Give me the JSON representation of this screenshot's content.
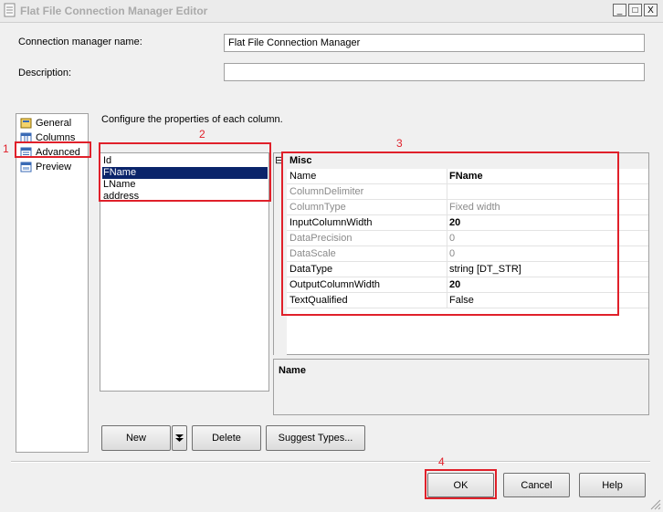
{
  "window": {
    "title": "Flat File Connection Manager Editor",
    "minimize_glyph": "_",
    "maximize_glyph": "□",
    "close_glyph": "X"
  },
  "form": {
    "name_label": "Connection manager name:",
    "name_value": "Flat File Connection Manager",
    "description_label": "Description:",
    "description_value": ""
  },
  "nav": {
    "items": [
      {
        "label": "General",
        "icon": "general-icon"
      },
      {
        "label": "Columns",
        "icon": "columns-icon"
      },
      {
        "label": "Advanced",
        "icon": "advanced-icon",
        "selected": true
      },
      {
        "label": "Preview",
        "icon": "preview-icon"
      }
    ]
  },
  "advanced": {
    "instruction": "Configure the properties of each column.",
    "columns": [
      "Id",
      "FName",
      "LName",
      "address"
    ],
    "selected_column": "FName"
  },
  "properties": {
    "category": "Misc",
    "collapse_glyph": "⊟",
    "rows": [
      {
        "name": "Name",
        "value": "FName",
        "enabled": true,
        "value_bold": true
      },
      {
        "name": "ColumnDelimiter",
        "value": "",
        "enabled": false,
        "value_bold": false
      },
      {
        "name": "ColumnType",
        "value": "Fixed width",
        "enabled": false,
        "value_bold": false
      },
      {
        "name": "InputColumnWidth",
        "value": "20",
        "enabled": true,
        "value_bold": true
      },
      {
        "name": "DataPrecision",
        "value": "0",
        "enabled": false,
        "value_bold": false
      },
      {
        "name": "DataScale",
        "value": "0",
        "enabled": false,
        "value_bold": false
      },
      {
        "name": "DataType",
        "value": "string [DT_STR]",
        "enabled": true,
        "value_bold": false
      },
      {
        "name": "OutputColumnWidth",
        "value": "20",
        "enabled": true,
        "value_bold": true
      },
      {
        "name": "TextQualified",
        "value": "False",
        "enabled": true,
        "value_bold": false
      }
    ],
    "description_title": "Name"
  },
  "buttons": {
    "new": "New",
    "delete": "Delete",
    "suggest_types": "Suggest Types...",
    "ok": "OK",
    "cancel": "Cancel",
    "help": "Help"
  },
  "annotations": {
    "n1": "1",
    "n2": "2",
    "n3": "3",
    "n4": "4",
    "color": "#e0202a"
  },
  "colors": {
    "selection": "#0a246a",
    "accent_red": "#e0202a"
  }
}
